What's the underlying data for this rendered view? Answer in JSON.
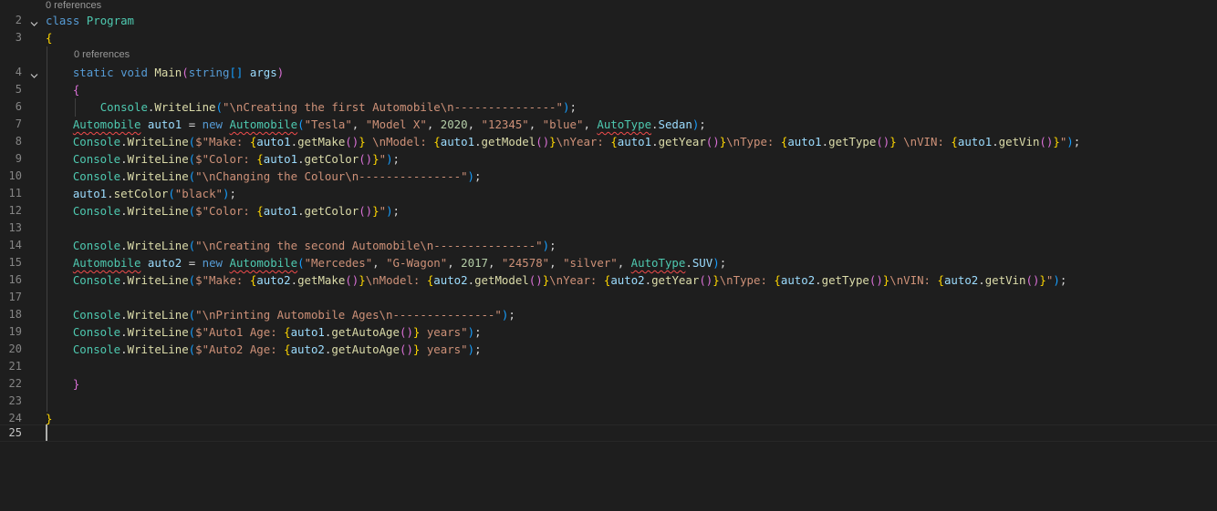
{
  "references_label": "0 references",
  "active_line": 25,
  "lines": [
    {
      "n": "2",
      "fold": true,
      "tokens": [
        [
          "kw",
          "class"
        ],
        [
          "pu",
          " "
        ],
        [
          "ty",
          "Program"
        ]
      ]
    },
    {
      "n": "3",
      "tokens": [
        [
          "b1",
          "{"
        ]
      ]
    },
    {
      "n": "4",
      "fold": true,
      "tokens": [
        [
          "pu",
          "    "
        ],
        [
          "kw",
          "static"
        ],
        [
          "pu",
          " "
        ],
        [
          "kw",
          "void"
        ],
        [
          "pu",
          " "
        ],
        [
          "fn",
          "Main"
        ],
        [
          "b2",
          "("
        ],
        [
          "kw",
          "string"
        ],
        [
          "b3",
          "[]"
        ],
        [
          "pu",
          " "
        ],
        [
          "va",
          "args"
        ],
        [
          "b2",
          ")"
        ]
      ]
    },
    {
      "n": "5",
      "tokens": [
        [
          "pu",
          "    "
        ],
        [
          "b2",
          "{"
        ]
      ]
    },
    {
      "n": "6",
      "tokens": [
        [
          "pu",
          "        "
        ],
        [
          "ty",
          "Console"
        ],
        [
          "pu",
          "."
        ],
        [
          "fn",
          "WriteLine"
        ],
        [
          "b3",
          "("
        ],
        [
          "st",
          "\"\\nCreating the first Automobile\\n---------------\""
        ],
        [
          "b3",
          ")"
        ],
        [
          "pu",
          ";"
        ]
      ]
    },
    {
      "n": "7",
      "tokens": [
        [
          "pu",
          "    "
        ],
        [
          "tysq",
          "Automobile"
        ],
        [
          "pu",
          " "
        ],
        [
          "va",
          "auto1"
        ],
        [
          "pu",
          " = "
        ],
        [
          "kw",
          "new"
        ],
        [
          "pu",
          " "
        ],
        [
          "tysq",
          "Automobile"
        ],
        [
          "b3",
          "("
        ],
        [
          "st",
          "\"Tesla\""
        ],
        [
          "pu",
          ", "
        ],
        [
          "st",
          "\"Model X\""
        ],
        [
          "pu",
          ", "
        ],
        [
          "nu",
          "2020"
        ],
        [
          "pu",
          ", "
        ],
        [
          "st",
          "\"12345\""
        ],
        [
          "pu",
          ", "
        ],
        [
          "st",
          "\"blue\""
        ],
        [
          "pu",
          ", "
        ],
        [
          "tysq",
          "AutoType"
        ],
        [
          "pu",
          "."
        ],
        [
          "va",
          "Sedan"
        ],
        [
          "b3",
          ")"
        ],
        [
          "pu",
          ";"
        ]
      ]
    },
    {
      "n": "8",
      "tokens": [
        [
          "pu",
          "    "
        ],
        [
          "ty",
          "Console"
        ],
        [
          "pu",
          "."
        ],
        [
          "fn",
          "WriteLine"
        ],
        [
          "b3",
          "("
        ],
        [
          "st",
          "$\"Make: "
        ],
        [
          "b1",
          "{"
        ],
        [
          "va",
          "auto1"
        ],
        [
          "pu",
          "."
        ],
        [
          "fn",
          "getMake"
        ],
        [
          "b2",
          "()"
        ],
        [
          "b1",
          "}"
        ],
        [
          "st",
          " \\nModel: "
        ],
        [
          "b1",
          "{"
        ],
        [
          "va",
          "auto1"
        ],
        [
          "pu",
          "."
        ],
        [
          "fn",
          "getModel"
        ],
        [
          "b2",
          "()"
        ],
        [
          "b1",
          "}"
        ],
        [
          "st",
          "\\nYear: "
        ],
        [
          "b1",
          "{"
        ],
        [
          "va",
          "auto1"
        ],
        [
          "pu",
          "."
        ],
        [
          "fn",
          "getYear"
        ],
        [
          "b2",
          "()"
        ],
        [
          "b1",
          "}"
        ],
        [
          "st",
          "\\nType: "
        ],
        [
          "b1",
          "{"
        ],
        [
          "va",
          "auto1"
        ],
        [
          "pu",
          "."
        ],
        [
          "fn",
          "getType"
        ],
        [
          "b2",
          "()"
        ],
        [
          "b1",
          "}"
        ],
        [
          "st",
          " \\nVIN: "
        ],
        [
          "b1",
          "{"
        ],
        [
          "va",
          "auto1"
        ],
        [
          "pu",
          "."
        ],
        [
          "fn",
          "getVin"
        ],
        [
          "b2",
          "()"
        ],
        [
          "b1",
          "}"
        ],
        [
          "st",
          "\""
        ],
        [
          "b3",
          ")"
        ],
        [
          "pu",
          ";"
        ]
      ]
    },
    {
      "n": "9",
      "tokens": [
        [
          "pu",
          "    "
        ],
        [
          "ty",
          "Console"
        ],
        [
          "pu",
          "."
        ],
        [
          "fn",
          "WriteLine"
        ],
        [
          "b3",
          "("
        ],
        [
          "st",
          "$\"Color: "
        ],
        [
          "b1",
          "{"
        ],
        [
          "va",
          "auto1"
        ],
        [
          "pu",
          "."
        ],
        [
          "fn",
          "getColor"
        ],
        [
          "b2",
          "()"
        ],
        [
          "b1",
          "}"
        ],
        [
          "st",
          "\""
        ],
        [
          "b3",
          ")"
        ],
        [
          "pu",
          ";"
        ]
      ]
    },
    {
      "n": "10",
      "tokens": [
        [
          "pu",
          "    "
        ],
        [
          "ty",
          "Console"
        ],
        [
          "pu",
          "."
        ],
        [
          "fn",
          "WriteLine"
        ],
        [
          "b3",
          "("
        ],
        [
          "st",
          "\"\\nChanging the Colour\\n---------------\""
        ],
        [
          "b3",
          ")"
        ],
        [
          "pu",
          ";"
        ]
      ]
    },
    {
      "n": "11",
      "tokens": [
        [
          "pu",
          "    "
        ],
        [
          "va",
          "auto1"
        ],
        [
          "pu",
          "."
        ],
        [
          "fn",
          "setColor"
        ],
        [
          "b3",
          "("
        ],
        [
          "st",
          "\"black\""
        ],
        [
          "b3",
          ")"
        ],
        [
          "pu",
          ";"
        ]
      ]
    },
    {
      "n": "12",
      "tokens": [
        [
          "pu",
          "    "
        ],
        [
          "ty",
          "Console"
        ],
        [
          "pu",
          "."
        ],
        [
          "fn",
          "WriteLine"
        ],
        [
          "b3",
          "("
        ],
        [
          "st",
          "$\"Color: "
        ],
        [
          "b1",
          "{"
        ],
        [
          "va",
          "auto1"
        ],
        [
          "pu",
          "."
        ],
        [
          "fn",
          "getColor"
        ],
        [
          "b2",
          "()"
        ],
        [
          "b1",
          "}"
        ],
        [
          "st",
          "\""
        ],
        [
          "b3",
          ")"
        ],
        [
          "pu",
          ";"
        ]
      ]
    },
    {
      "n": "13",
      "tokens": []
    },
    {
      "n": "14",
      "tokens": [
        [
          "pu",
          "    "
        ],
        [
          "ty",
          "Console"
        ],
        [
          "pu",
          "."
        ],
        [
          "fn",
          "WriteLine"
        ],
        [
          "b3",
          "("
        ],
        [
          "st",
          "\"\\nCreating the second Automobile\\n---------------\""
        ],
        [
          "b3",
          ")"
        ],
        [
          "pu",
          ";"
        ]
      ]
    },
    {
      "n": "15",
      "tokens": [
        [
          "pu",
          "    "
        ],
        [
          "tysq",
          "Automobile"
        ],
        [
          "pu",
          " "
        ],
        [
          "va",
          "auto2"
        ],
        [
          "pu",
          " = "
        ],
        [
          "kw",
          "new"
        ],
        [
          "pu",
          " "
        ],
        [
          "tysq",
          "Automobile"
        ],
        [
          "b3",
          "("
        ],
        [
          "st",
          "\"Mercedes\""
        ],
        [
          "pu",
          ", "
        ],
        [
          "st",
          "\"G-Wagon\""
        ],
        [
          "pu",
          ", "
        ],
        [
          "nu",
          "2017"
        ],
        [
          "pu",
          ", "
        ],
        [
          "st",
          "\"24578\""
        ],
        [
          "pu",
          ", "
        ],
        [
          "st",
          "\"silver\""
        ],
        [
          "pu",
          ", "
        ],
        [
          "tysq",
          "AutoType"
        ],
        [
          "pu",
          "."
        ],
        [
          "va",
          "SUV"
        ],
        [
          "b3",
          ")"
        ],
        [
          "pu",
          ";"
        ]
      ]
    },
    {
      "n": "16",
      "tokens": [
        [
          "pu",
          "    "
        ],
        [
          "ty",
          "Console"
        ],
        [
          "pu",
          "."
        ],
        [
          "fn",
          "WriteLine"
        ],
        [
          "b3",
          "("
        ],
        [
          "st",
          "$\"Make: "
        ],
        [
          "b1",
          "{"
        ],
        [
          "va",
          "auto2"
        ],
        [
          "pu",
          "."
        ],
        [
          "fn",
          "getMake"
        ],
        [
          "b2",
          "()"
        ],
        [
          "b1",
          "}"
        ],
        [
          "st",
          "\\nModel: "
        ],
        [
          "b1",
          "{"
        ],
        [
          "va",
          "auto2"
        ],
        [
          "pu",
          "."
        ],
        [
          "fn",
          "getModel"
        ],
        [
          "b2",
          "()"
        ],
        [
          "b1",
          "}"
        ],
        [
          "st",
          "\\nYear: "
        ],
        [
          "b1",
          "{"
        ],
        [
          "va",
          "auto2"
        ],
        [
          "pu",
          "."
        ],
        [
          "fn",
          "getYear"
        ],
        [
          "b2",
          "()"
        ],
        [
          "b1",
          "}"
        ],
        [
          "st",
          "\\nType: "
        ],
        [
          "b1",
          "{"
        ],
        [
          "va",
          "auto2"
        ],
        [
          "pu",
          "."
        ],
        [
          "fn",
          "getType"
        ],
        [
          "b2",
          "()"
        ],
        [
          "b1",
          "}"
        ],
        [
          "st",
          "\\nVIN: "
        ],
        [
          "b1",
          "{"
        ],
        [
          "va",
          "auto2"
        ],
        [
          "pu",
          "."
        ],
        [
          "fn",
          "getVin"
        ],
        [
          "b2",
          "()"
        ],
        [
          "b1",
          "}"
        ],
        [
          "st",
          "\""
        ],
        [
          "b3",
          ")"
        ],
        [
          "pu",
          ";"
        ]
      ]
    },
    {
      "n": "17",
      "tokens": []
    },
    {
      "n": "18",
      "tokens": [
        [
          "pu",
          "    "
        ],
        [
          "ty",
          "Console"
        ],
        [
          "pu",
          "."
        ],
        [
          "fn",
          "WriteLine"
        ],
        [
          "b3",
          "("
        ],
        [
          "st",
          "\"\\nPrinting Automobile Ages\\n---------------\""
        ],
        [
          "b3",
          ")"
        ],
        [
          "pu",
          ";"
        ]
      ]
    },
    {
      "n": "19",
      "tokens": [
        [
          "pu",
          "    "
        ],
        [
          "ty",
          "Console"
        ],
        [
          "pu",
          "."
        ],
        [
          "fn",
          "WriteLine"
        ],
        [
          "b3",
          "("
        ],
        [
          "st",
          "$\"Auto1 Age: "
        ],
        [
          "b1",
          "{"
        ],
        [
          "va",
          "auto1"
        ],
        [
          "pu",
          "."
        ],
        [
          "fn",
          "getAutoAge"
        ],
        [
          "b2",
          "()"
        ],
        [
          "b1",
          "}"
        ],
        [
          "st",
          " years\""
        ],
        [
          "b3",
          ")"
        ],
        [
          "pu",
          ";"
        ]
      ]
    },
    {
      "n": "20",
      "tokens": [
        [
          "pu",
          "    "
        ],
        [
          "ty",
          "Console"
        ],
        [
          "pu",
          "."
        ],
        [
          "fn",
          "WriteLine"
        ],
        [
          "b3",
          "("
        ],
        [
          "st",
          "$\"Auto2 Age: "
        ],
        [
          "b1",
          "{"
        ],
        [
          "va",
          "auto2"
        ],
        [
          "pu",
          "."
        ],
        [
          "fn",
          "getAutoAge"
        ],
        [
          "b2",
          "()"
        ],
        [
          "b1",
          "}"
        ],
        [
          "st",
          " years\""
        ],
        [
          "b3",
          ")"
        ],
        [
          "pu",
          ";"
        ]
      ]
    },
    {
      "n": "21",
      "tokens": []
    },
    {
      "n": "22",
      "tokens": [
        [
          "pu",
          "    "
        ],
        [
          "b2",
          "}"
        ]
      ]
    },
    {
      "n": "23",
      "tokens": []
    },
    {
      "n": "24",
      "tokens": [
        [
          "b1",
          "}"
        ]
      ]
    },
    {
      "n": "25",
      "tokens": []
    }
  ]
}
